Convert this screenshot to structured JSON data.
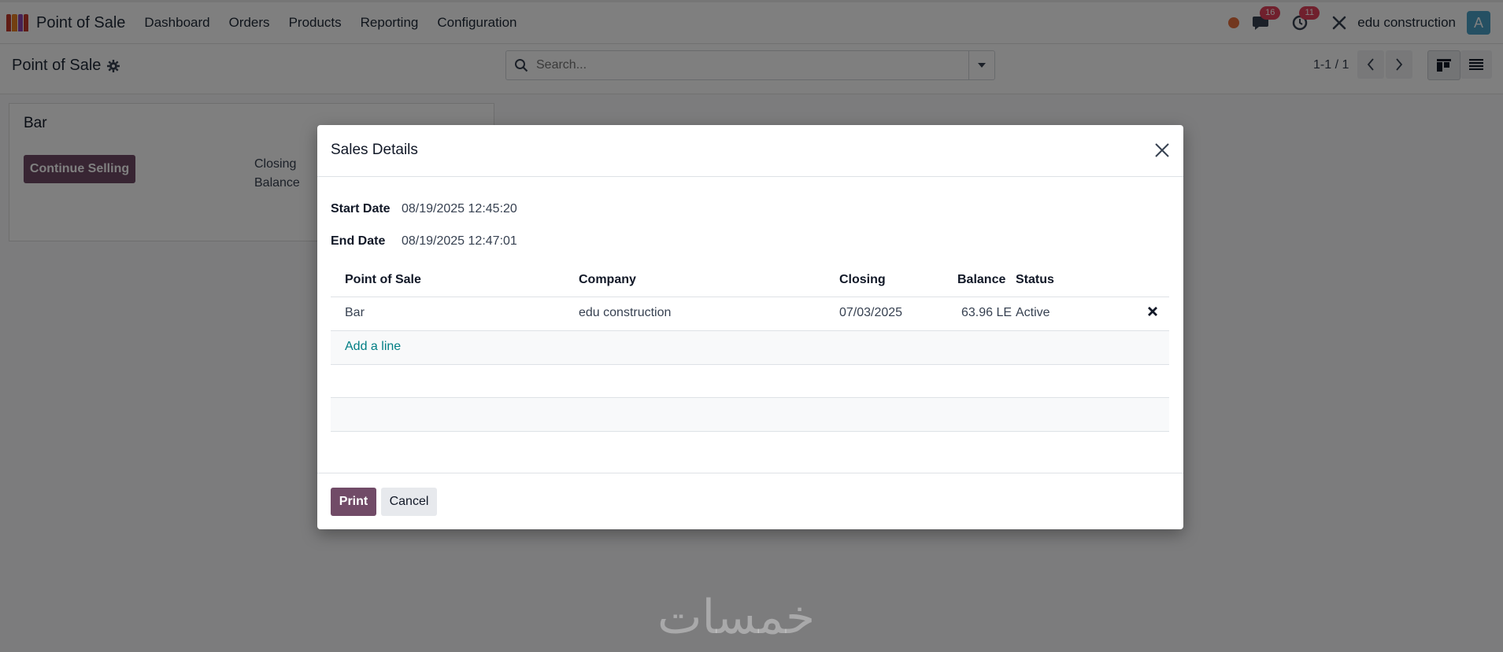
{
  "navbar": {
    "app_name": "Point of Sale",
    "menu": [
      "Dashboard",
      "Orders",
      "Products",
      "Reporting",
      "Configuration"
    ],
    "messages_count": "16",
    "activities_count": "11",
    "company_name": "edu construction",
    "avatar_letter": "A"
  },
  "control_panel": {
    "breadcrumb": "Point of Sale",
    "search_placeholder": "Search...",
    "pager": "1-1 / 1"
  },
  "card": {
    "title": "Bar",
    "continue_label": "Continue Selling",
    "closing_label": "Closing",
    "balance_label": "Balance"
  },
  "dialog": {
    "title": "Sales Details",
    "start_date_label": "Start Date",
    "start_date_value": "08/19/2025 12:45:20",
    "end_date_label": "End Date",
    "end_date_value": "08/19/2025 12:47:01",
    "table": {
      "headers": [
        "Point of Sale",
        "Company",
        "Closing",
        "Balance",
        "Status"
      ],
      "rows": [
        {
          "pos": "Bar",
          "company": "edu construction",
          "closing": "07/03/2025",
          "balance": "63.96 LE",
          "status": "Active"
        }
      ],
      "add_line_label": "Add a line"
    },
    "print_label": "Print",
    "cancel_label": "Cancel"
  },
  "watermark": "خمسات",
  "colors": {
    "primary": "#714b67",
    "link": "#017e84",
    "badge": "#e0405a",
    "avatar": "#4aa0c7"
  }
}
